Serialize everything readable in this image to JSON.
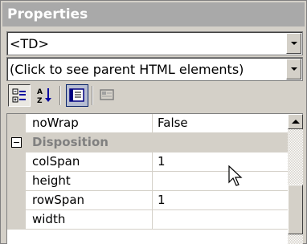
{
  "panel": {
    "title": "Properties",
    "element_selector": {
      "value": "<TD>"
    },
    "parent_selector": {
      "value": "(Click to see parent HTML elements)"
    },
    "toolbar": {
      "buttons": [
        {
          "name": "categorized",
          "icon": "categorized-icon",
          "state": "pressed"
        },
        {
          "name": "alphabetic",
          "icon": "sort-alphabetic-icon",
          "state": "normal"
        },
        {
          "name": "properties",
          "icon": "properties-page-icon",
          "state": "hot"
        },
        {
          "name": "events",
          "icon": "events-icon",
          "state": "disabled"
        }
      ]
    },
    "grid": {
      "rows": [
        {
          "type": "property",
          "name": "noWrap",
          "value": "False"
        },
        {
          "type": "category",
          "name": "Disposition",
          "expanded": true
        },
        {
          "type": "property",
          "name": "colSpan",
          "value": "1"
        },
        {
          "type": "property",
          "name": "height",
          "value": ""
        },
        {
          "type": "property",
          "name": "rowSpan",
          "value": "1"
        },
        {
          "type": "property",
          "name": "width",
          "value": ""
        }
      ]
    }
  },
  "colors": {
    "title_bar": "#a9a9a9",
    "face": "#d4d0c8",
    "grid_background": "#ffffff",
    "category_text": "#808080"
  }
}
